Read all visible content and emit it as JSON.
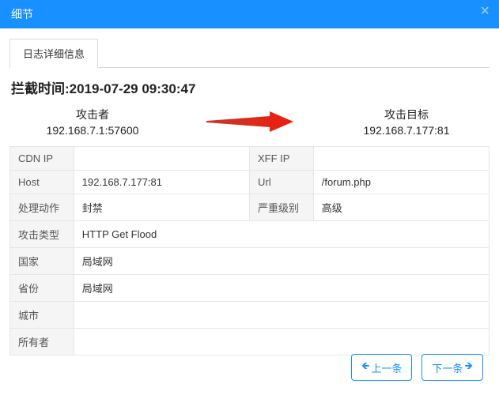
{
  "header": {
    "title": "细节"
  },
  "tab": {
    "label": "日志详细信息"
  },
  "block_title": "拦截时间:2019-07-29 09:30:47",
  "attacker": {
    "label": "攻击者",
    "value": "192.168.7.1:57600"
  },
  "target": {
    "label": "攻击目标",
    "value": "192.168.7.177:81"
  },
  "rows": {
    "cdn_ip_label": "CDN IP",
    "cdn_ip_value": "",
    "xff_ip_label": "XFF IP",
    "xff_ip_value": "",
    "host_label": "Host",
    "host_value": "192.168.7.177:81",
    "url_label": "Url",
    "url_value": "/forum.php",
    "action_label": "处理动作",
    "action_value": "封禁",
    "severity_label": "严重级别",
    "severity_value": "高级",
    "attack_type_label": "攻击类型",
    "attack_type_value": "HTTP Get Flood",
    "country_label": "国家",
    "country_value": "局域网",
    "province_label": "省份",
    "province_value": "局域网",
    "city_label": "城市",
    "city_value": "",
    "owner_label": "所有者",
    "owner_value": ""
  },
  "footer": {
    "prev": "上一条",
    "next": "下一条"
  }
}
